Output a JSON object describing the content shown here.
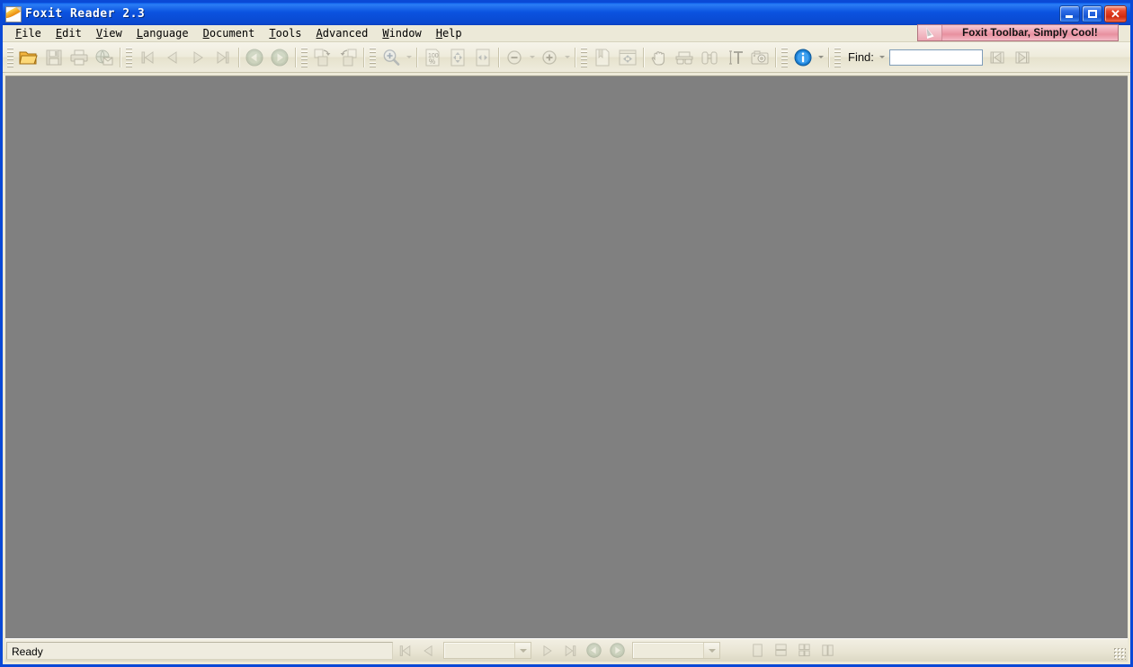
{
  "window": {
    "title": "Foxit Reader 2.3",
    "app_icon": "foxit-document-icon",
    "controls": {
      "minimize": "Minimize",
      "maximize": "Maximize",
      "close": "Close"
    }
  },
  "menubar": {
    "items": [
      {
        "label": "File",
        "accel": "F"
      },
      {
        "label": "Edit",
        "accel": "E"
      },
      {
        "label": "View",
        "accel": "V"
      },
      {
        "label": "Language",
        "accel": "L"
      },
      {
        "label": "Document",
        "accel": "D"
      },
      {
        "label": "Tools",
        "accel": "T"
      },
      {
        "label": "Advanced",
        "accel": "A"
      },
      {
        "label": "Window",
        "accel": "W"
      },
      {
        "label": "Help",
        "accel": "H"
      }
    ]
  },
  "promo": {
    "text": "Foxit Toolbar, Simply Cool!",
    "icon": "cursor-arrow-icon",
    "bg_color": "#f0a8b6",
    "border_color": "#b0727e"
  },
  "toolbar": {
    "groups": [
      {
        "name": "file",
        "buttons": [
          {
            "name": "open-button",
            "icon": "open-folder-icon",
            "enabled": true
          },
          {
            "name": "save-button",
            "icon": "floppy-save-icon",
            "enabled": false
          },
          {
            "name": "print-button",
            "icon": "printer-icon",
            "enabled": false
          },
          {
            "name": "email-button",
            "icon": "globe-mail-icon",
            "enabled": false
          }
        ]
      },
      {
        "name": "navigation",
        "buttons": [
          {
            "name": "first-page-button",
            "icon": "first-page-icon",
            "enabled": false
          },
          {
            "name": "previous-page-button",
            "icon": "previous-page-icon",
            "enabled": false
          },
          {
            "name": "next-page-button",
            "icon": "next-page-icon",
            "enabled": false
          },
          {
            "name": "last-page-button",
            "icon": "last-page-icon",
            "enabled": false
          }
        ]
      },
      {
        "name": "view-history",
        "buttons": [
          {
            "name": "previous-view-button",
            "icon": "back-arrow-circle-icon",
            "enabled": false
          },
          {
            "name": "next-view-button",
            "icon": "forward-arrow-circle-icon",
            "enabled": false
          }
        ]
      },
      {
        "name": "rotate",
        "buttons": [
          {
            "name": "rotate-clockwise-button",
            "icon": "rotate-clockwise-icon",
            "enabled": false
          },
          {
            "name": "rotate-counterclockwise-button",
            "icon": "rotate-counterclockwise-icon",
            "enabled": false
          }
        ]
      },
      {
        "name": "zoom-tool",
        "buttons": [
          {
            "name": "zoom-tool-button",
            "icon": "magnifier-plus-icon",
            "enabled": false,
            "has_dropdown": true
          }
        ]
      },
      {
        "name": "zoom-presets",
        "buttons": [
          {
            "name": "actual-size-button",
            "icon": "100-percent-icon",
            "label": "100",
            "enabled": false
          },
          {
            "name": "fit-page-button",
            "icon": "fit-page-icon",
            "enabled": false
          },
          {
            "name": "fit-width-button",
            "icon": "fit-width-icon",
            "enabled": false
          }
        ]
      },
      {
        "name": "zoom-steps",
        "buttons": [
          {
            "name": "zoom-out-button",
            "icon": "zoom-out-minus-icon",
            "enabled": false,
            "has_dropdown": true
          },
          {
            "name": "zoom-in-button",
            "icon": "zoom-in-plus-icon",
            "enabled": false,
            "has_dropdown": true
          }
        ]
      },
      {
        "name": "display",
        "buttons": [
          {
            "name": "page-display-button",
            "icon": "bookmark-page-icon",
            "enabled": false
          },
          {
            "name": "full-screen-button",
            "icon": "full-screen-icon",
            "enabled": false
          }
        ]
      },
      {
        "name": "tools",
        "buttons": [
          {
            "name": "hand-tool-button",
            "icon": "hand-icon",
            "enabled": false
          },
          {
            "name": "select-text-button",
            "icon": "select-glasses-icon",
            "enabled": false
          },
          {
            "name": "find-tool-button",
            "icon": "binoculars-icon",
            "enabled": false
          },
          {
            "name": "text-viewer-button",
            "icon": "text-cursor-T-icon",
            "enabled": false
          },
          {
            "name": "snapshot-button",
            "icon": "camera-snapshot-icon",
            "enabled": false
          }
        ]
      },
      {
        "name": "info",
        "buttons": [
          {
            "name": "about-info-button",
            "icon": "info-circle-icon",
            "enabled": true,
            "has_dropdown": true
          }
        ]
      }
    ],
    "find": {
      "label": "Find:",
      "value": "",
      "placeholder": "",
      "dropdown_icon": "chevron-down-icon",
      "previous_button": {
        "name": "find-previous-button",
        "icon": "find-previous-icon",
        "enabled": false
      },
      "next_button": {
        "name": "find-next-button",
        "icon": "find-next-icon",
        "enabled": false
      }
    }
  },
  "document_area": {
    "background_color": "#808080",
    "content": ""
  },
  "statusbar": {
    "status_text": "Ready",
    "navigation": [
      {
        "name": "status-first-page-button",
        "icon": "first-page-icon",
        "enabled": false
      },
      {
        "name": "status-previous-page-button",
        "icon": "previous-page-icon",
        "enabled": false
      }
    ],
    "page_combo": {
      "value": "",
      "arrow_icon": "chevron-down-icon"
    },
    "navigation2": [
      {
        "name": "status-next-page-button",
        "icon": "next-page-icon",
        "enabled": false
      },
      {
        "name": "status-last-page-button",
        "icon": "last-page-icon",
        "enabled": false
      }
    ],
    "view_history": [
      {
        "name": "status-previous-view-button",
        "icon": "back-arrow-circle-icon",
        "enabled": false
      },
      {
        "name": "status-next-view-button",
        "icon": "forward-arrow-circle-icon",
        "enabled": false
      }
    ],
    "zoom_combo": {
      "value": "",
      "arrow_icon": "chevron-down-icon"
    },
    "layout_buttons": [
      {
        "name": "single-page-layout-button",
        "icon": "single-page-icon",
        "enabled": false
      },
      {
        "name": "continuous-layout-button",
        "icon": "continuous-pages-icon",
        "enabled": false
      },
      {
        "name": "continuous-facing-layout-button",
        "icon": "continuous-facing-icon",
        "enabled": false
      },
      {
        "name": "facing-layout-button",
        "icon": "facing-pages-icon",
        "enabled": false
      }
    ],
    "resize_grip": "resize-grip-icon"
  },
  "colors": {
    "titlebar": "#0b53e0",
    "chrome": "#ece9d8",
    "toolbar": "#eeebdb",
    "document": "#808080",
    "close_button": "#e8472a"
  }
}
